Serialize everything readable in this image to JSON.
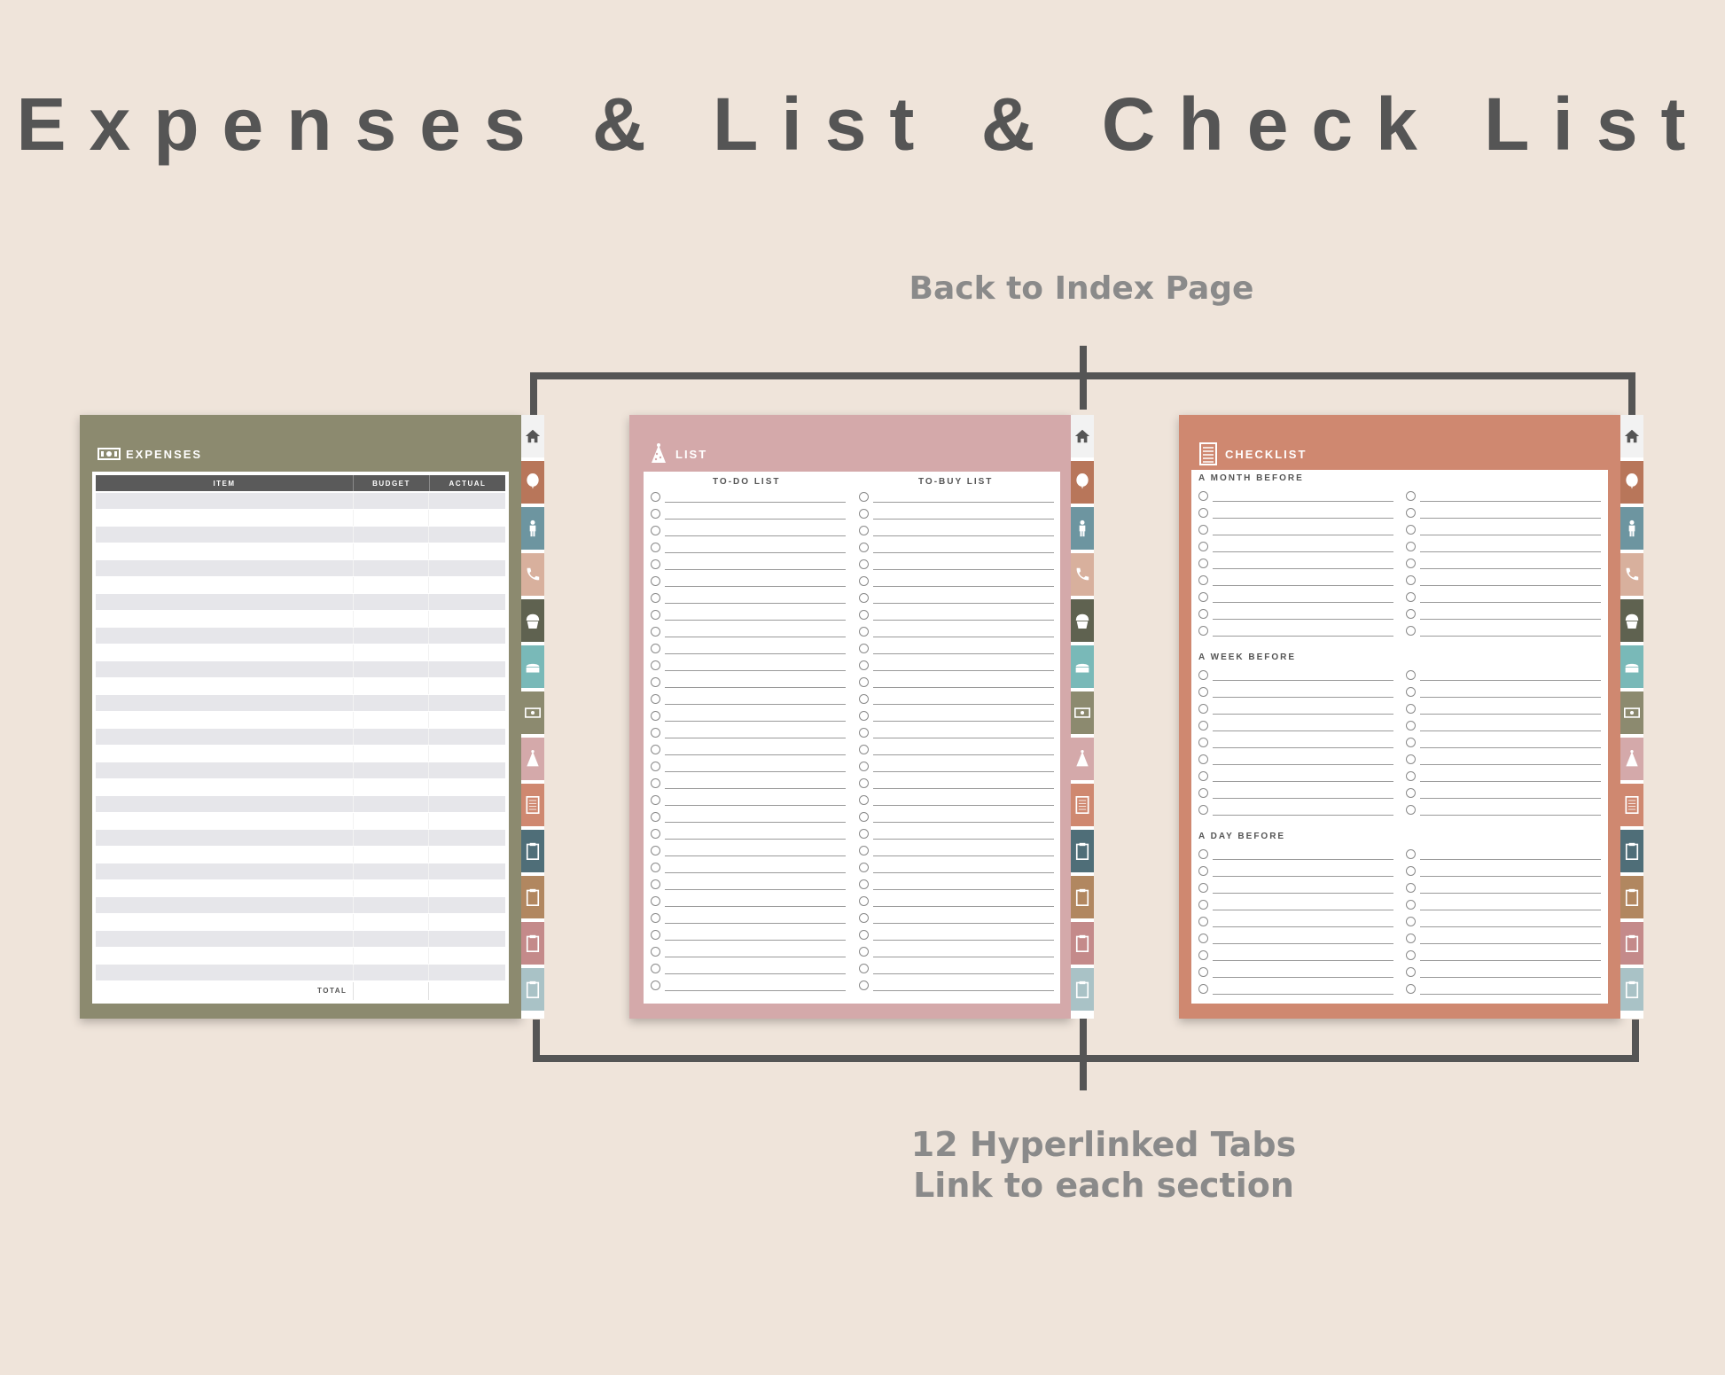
{
  "title": "Expenses & List & Check List",
  "top_caption": "Back to Index Page",
  "bottom_caption": [
    "12 Hyperlinked Tabs",
    "Link to each section"
  ],
  "colors": {
    "background": "#efe4da",
    "expenses_page": "#8c8a6f",
    "list_page": "#d4a9aa",
    "checklist_page": "#cf8870",
    "bracket": "#555555"
  },
  "tabs": [
    {
      "icon": "home-icon",
      "color": "#f2f2f2"
    },
    {
      "icon": "balloon-icon",
      "color": "#b8765a"
    },
    {
      "icon": "person-icon",
      "color": "#6d95a0"
    },
    {
      "icon": "phone-icon",
      "color": "#d8b09d"
    },
    {
      "icon": "cupcake-icon",
      "color": "#5f6250"
    },
    {
      "icon": "cake-icon",
      "color": "#79b9b8"
    },
    {
      "icon": "money-icon",
      "color": "#8c8a6f"
    },
    {
      "icon": "party-hat-icon",
      "color": "#d4a9aa"
    },
    {
      "icon": "checklist-icon",
      "color": "#cf8870"
    },
    {
      "icon": "clipboard-icon",
      "color": "#4f6e78"
    },
    {
      "icon": "clipboard-icon",
      "color": "#b18760"
    },
    {
      "icon": "clipboard-icon",
      "color": "#c48a8a"
    },
    {
      "icon": "clipboard-icon",
      "color": "#a9c2c6"
    }
  ],
  "expenses": {
    "heading": "EXPENSES",
    "columns": [
      "ITEM",
      "BUDGET",
      "ACTUAL"
    ],
    "total_label": "TOTAL"
  },
  "list": {
    "heading": "LIST",
    "columns": [
      "TO-DO LIST",
      "TO-BUY LIST"
    ]
  },
  "checklist": {
    "heading": "CHECKLIST",
    "sections": [
      "A MONTH BEFORE",
      "A WEEK BEFORE",
      "A DAY BEFORE"
    ]
  }
}
